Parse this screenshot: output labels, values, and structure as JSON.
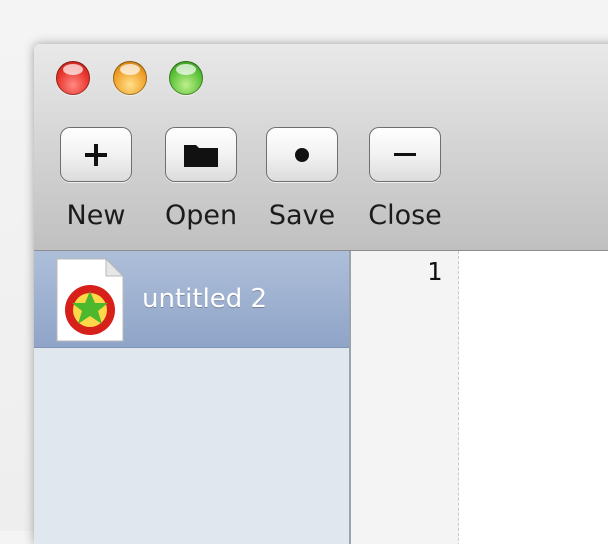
{
  "toolbar": {
    "buttons": [
      {
        "label": "New",
        "icon": "plus-icon"
      },
      {
        "label": "Open",
        "icon": "folder-icon"
      },
      {
        "label": "Save",
        "icon": "dot-icon"
      },
      {
        "label": "Close",
        "icon": "minus-icon"
      }
    ]
  },
  "sidebar": {
    "documents": [
      {
        "name": "untitled 2",
        "icon": "document-icon",
        "selected": true
      }
    ]
  },
  "editor": {
    "line_numbers": [
      "1"
    ]
  },
  "colors": {
    "traffic_close": "#e8332b",
    "traffic_minimize": "#f1a12a",
    "traffic_maximize": "#5cc23a",
    "selection": "#9aaed0"
  }
}
